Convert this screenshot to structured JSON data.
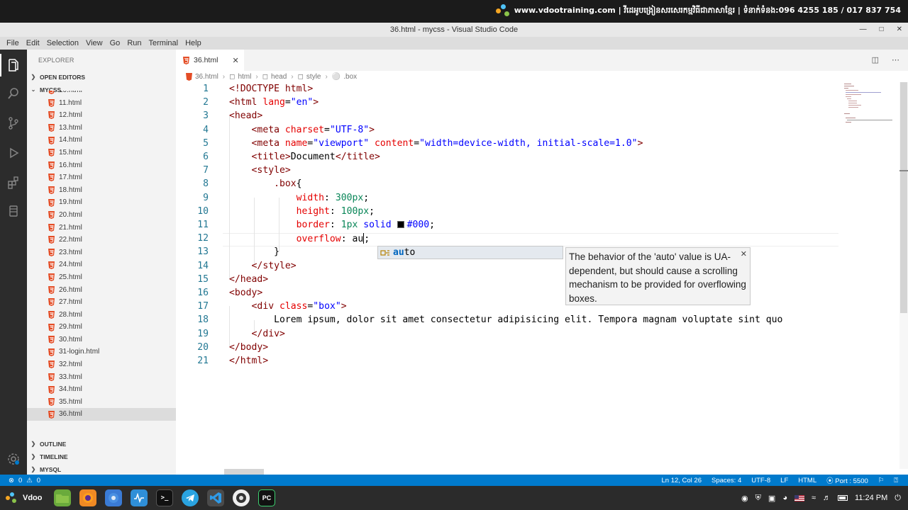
{
  "topbar": {
    "brand_text": "www.vdootraining.com | វីដេអូបង្រៀនសរសេរកម្មវិធីជាភាសាខ្មែរ | ទំនាក់ទំនង:096 4255 185 / 017 837 754"
  },
  "window": {
    "title": "36.html - mycss - Visual Studio Code"
  },
  "menu": [
    "File",
    "Edit",
    "Selection",
    "View",
    "Go",
    "Run",
    "Terminal",
    "Help"
  ],
  "sidebar": {
    "header": "EXPLORER",
    "open_editors": "OPEN EDITORS",
    "folder": "MYCSS",
    "files": [
      "10.html",
      "11.html",
      "12.html",
      "13.html",
      "14.html",
      "15.html",
      "16.html",
      "17.html",
      "18.html",
      "19.html",
      "20.html",
      "21.html",
      "22.html",
      "23.html",
      "24.html",
      "25.html",
      "26.html",
      "27.html",
      "28.html",
      "29.html",
      "30.html",
      "31-login.html",
      "32.html",
      "33.html",
      "34.html",
      "35.html",
      "36.html"
    ],
    "active_file": "36.html",
    "outline": "OUTLINE",
    "timeline": "TIMELINE",
    "mysql": "MYSQL"
  },
  "tab": {
    "label": "36.html"
  },
  "breadcrumb": [
    "36.html",
    "html",
    "head",
    "style",
    ".box"
  ],
  "editor": {
    "line_numbers": [
      "1",
      "2",
      "3",
      "4",
      "5",
      "6",
      "7",
      "8",
      "9",
      "10",
      "11",
      "12",
      "13",
      "14",
      "15",
      "16",
      "17",
      "18",
      "19",
      "20",
      "21"
    ],
    "color_value": "#000",
    "lorem": "Lorem ipsum, dolor sit amet consectetur adipisicing elit. Tempora magnam voluptate sint quo"
  },
  "suggest": {
    "match": "au",
    "rest": "to"
  },
  "hover_doc": {
    "text": "The behavior of the 'auto' value is UA-dependent, but should cause a scrolling mechanism to be provided for overflowing boxes."
  },
  "statusbar": {
    "errors": "0",
    "warnings": "0",
    "position": "Ln 12, Col 26",
    "spaces": "Spaces: 4",
    "encoding": "UTF-8",
    "eol": "LF",
    "language": "HTML",
    "port": "Port : 5500"
  },
  "taskbar": {
    "start_label": "Vdoo",
    "time": "11:24 PM"
  },
  "colors": {
    "accent": "#007acc",
    "tag": "#800000",
    "attr": "#e50000",
    "string": "#0000ff",
    "number": "#098658"
  }
}
